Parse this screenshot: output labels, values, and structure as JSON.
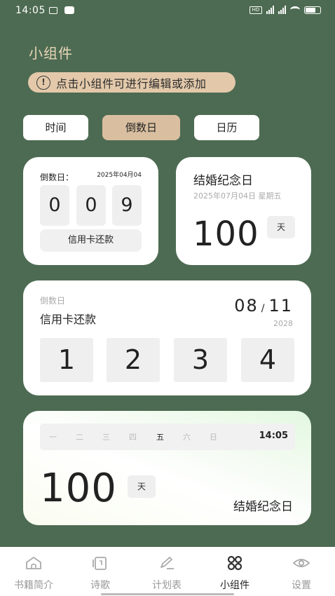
{
  "status_bar": {
    "time": "14:05"
  },
  "page_title": "小组件",
  "hint": {
    "icon": "info-icon",
    "glyph": "!",
    "text": "点击小组件可进行编辑或添加"
  },
  "tabs": [
    {
      "label": "时间",
      "active": false
    },
    {
      "label": "倒数日",
      "active": true
    },
    {
      "label": "日历",
      "active": false
    }
  ],
  "countdown_small": {
    "label": "倒数日：",
    "date": "2025年04月04",
    "digits": [
      "0",
      "0",
      "9"
    ],
    "name": "信用卡还款"
  },
  "anniversary_small": {
    "title": "结婚纪念日",
    "subtitle": "2025年07月04日 星期五",
    "number": "100",
    "unit": "天"
  },
  "countdown_wide": {
    "label": "倒数日",
    "name": "信用卡还款",
    "month": "08",
    "slash": "/",
    "day": "11",
    "year": "2028",
    "digits": [
      "1",
      "2",
      "3",
      "4"
    ]
  },
  "anniversary_wide": {
    "weekdays": [
      "一",
      "二",
      "三",
      "四",
      "五",
      "六",
      "日"
    ],
    "current_weekday_index": 4,
    "time": "14:05",
    "number": "100",
    "unit": "天",
    "name": "结婚纪念日"
  },
  "bottom_nav": [
    {
      "label": "书籍简介",
      "icon": "home-icon",
      "active": false
    },
    {
      "label": "诗歌",
      "icon": "book-icon",
      "active": false
    },
    {
      "label": "计划表",
      "icon": "pen-icon",
      "active": false
    },
    {
      "label": "小组件",
      "icon": "widgets-icon",
      "active": true
    },
    {
      "label": "设置",
      "icon": "eye-icon",
      "active": false
    }
  ]
}
